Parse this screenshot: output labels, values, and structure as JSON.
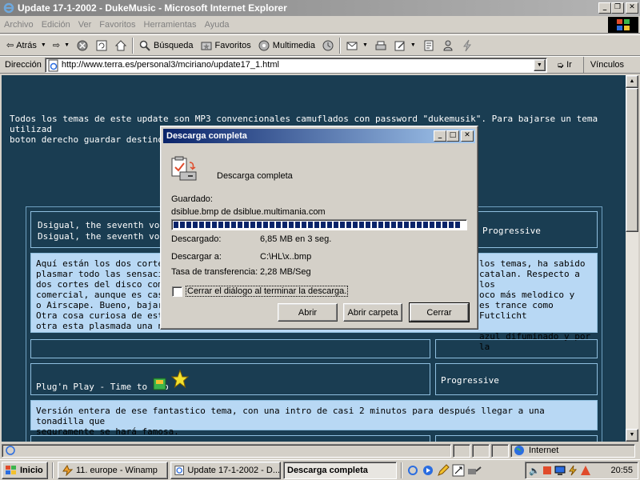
{
  "window": {
    "title": "Update 17-1-2002 - DukeMusic - Microsoft Internet Explorer"
  },
  "menu": [
    "Archivo",
    "Edición",
    "Ver",
    "Favoritos",
    "Herramientas",
    "Ayuda"
  ],
  "toolbar": {
    "back": "Atrás",
    "search": "Búsqueda",
    "favorites": "Favoritos",
    "media": "Multimedia"
  },
  "address": {
    "label": "Dirección",
    "url": "http://www.terra.es/personal3/mciriano/update17_1.html",
    "go": "Ir",
    "links": "Vínculos"
  },
  "page": {
    "intro_1": "Todos los temas de este update son MP3 convencionales camuflados con password \"dukemusik\". Para bajarse un tema utilizad",
    "intro_2": "boton derecho guardar destino c",
    "row1_line1": "Dsigual, the seventh vol - E",
    "row1_line2": "Dsigual, the seventh vol - C",
    "row1_genre": "Progressive",
    "desc1_lines": [
      "Aquí están los dos cortes de",
      "plasmar todo las sensacion",
      "dos cortes del disco coment",
      "comercial, aunque es casi t",
      "o Airscape. Bueno, bajarolc",
      "Otra cosa curiosa de este m",
      "otra esta plasmada una nar"
    ],
    "desc1_right": [
      "los temas, ha sabido",
      "catalan. Respecto a los",
      "oco más melodico y",
      "es trance como Futclicht",
      "",
      "azul difuminado y por la",
      ""
    ],
    "row3_title": "Plug'n Play - Time to bob",
    "row3_genre": "Progressive",
    "desc2_line1": "Versión entera de ese fantastico tema, con una intro de casi 2 minutos para después llegar a una tonadilla que",
    "desc2_line2": "seguramente se hará famosa."
  },
  "status": {
    "zone": "Internet"
  },
  "taskbar": {
    "start": "Inicio",
    "tasks": [
      "11. europe - Winamp",
      "Update 17-1-2002 - D...",
      "Descarga completa"
    ],
    "clock": "20:55"
  },
  "dialog": {
    "title": "Descarga completa",
    "heading": "Descarga completa",
    "saved_label": "Guardado:",
    "saved_value": "dsiblue.bmp de dsiblue.multimania.com",
    "downloaded_label": "Descargado:",
    "downloaded_value": "6,85 MB en 3 seg.",
    "target_label": "Descargar a:",
    "target_value": "C:\\HL\\x..bmp",
    "rate_label": "Tasa de transferencia:",
    "rate_value": "2,28 MB/Seg",
    "close_checkbox": "Cerrar el diálogo al terminar la descarga.",
    "progress": 1.0,
    "btn_open": "Abrir",
    "btn_open_folder": "Abrir carpeta",
    "btn_close": "Cerrar"
  }
}
